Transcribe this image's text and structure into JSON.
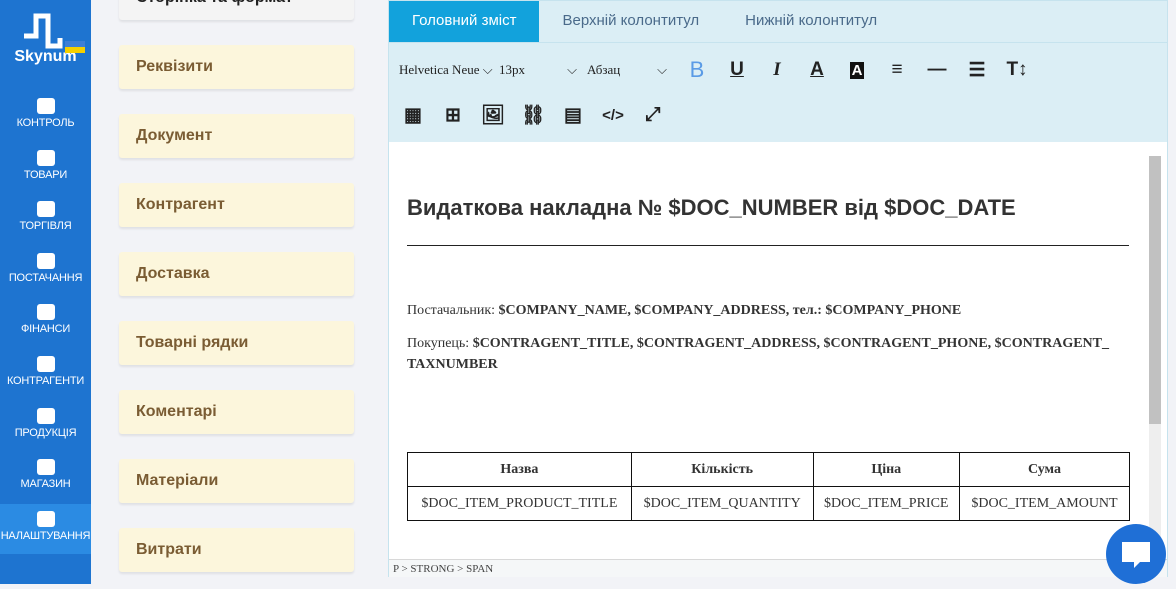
{
  "brand": "Skynum",
  "nav": [
    {
      "label": "КОНТРОЛЬ",
      "icon": "chart-growth-icon"
    },
    {
      "label": "ТОВАРИ",
      "icon": "tag-icon"
    },
    {
      "label": "ТОРГІВЛЯ",
      "icon": "cash-register-icon"
    },
    {
      "label": "ПОСТАЧАННЯ",
      "icon": "truck-icon"
    },
    {
      "label": "ФІНАНСИ",
      "icon": "wallet-icon"
    },
    {
      "label": "КОНТРАГЕНТИ",
      "icon": "person-icon"
    },
    {
      "label": "ПРОДУКЦІЯ",
      "icon": "factory-icon"
    },
    {
      "label": "МАГАЗИН",
      "icon": "shop-bag-icon"
    },
    {
      "label": "НАЛАШТУВАННЯ",
      "icon": "settings-tools-icon",
      "active": true
    }
  ],
  "sections": [
    "Сторінка та формат",
    "Реквізити",
    "Документ",
    "Контрагент",
    "Доставка",
    "Товарні рядки",
    "Коментарі",
    "Матеріали",
    "Витрати"
  ],
  "editor": {
    "tabs": [
      "Головний зміст",
      "Верхній колонтитул",
      "Нижній колонтитул"
    ],
    "font": "Helvetica Neue",
    "size": "13px",
    "block": "Абзац",
    "title": "Видаткова накладна № $DOC_NUMBER від $DOC_DATE",
    "supplier_label": "Постачальник:",
    "supplier_value": "$COMPANY_NAME, $COMPANY_ADDRESS,  тел.: $COMPANY_PHONE",
    "buyer_label": "Покупець:",
    "buyer_value": "$CONTRAGENT_TITLE, $CONTRAGENT_ADDRESS, $CONTRAGENT_PHONE,  $CONTRAGENT_ TAXNUMBER",
    "table_headers": [
      "Назва",
      "Кількість",
      "Ціна",
      "Сума"
    ],
    "table_row": [
      "$DOC_ITEM_PRODUCT_TITLE",
      "$DOC_ITEM_QUANTITY",
      "$DOC_ITEM_PRICE",
      "$DOC_ITEM_AMOUNT"
    ],
    "status_path": "P > STRONG > SPAN"
  },
  "colors": {
    "sidebar": "#1e74d0",
    "active_tab": "#12a2dc",
    "card": "#fcf6dc"
  }
}
